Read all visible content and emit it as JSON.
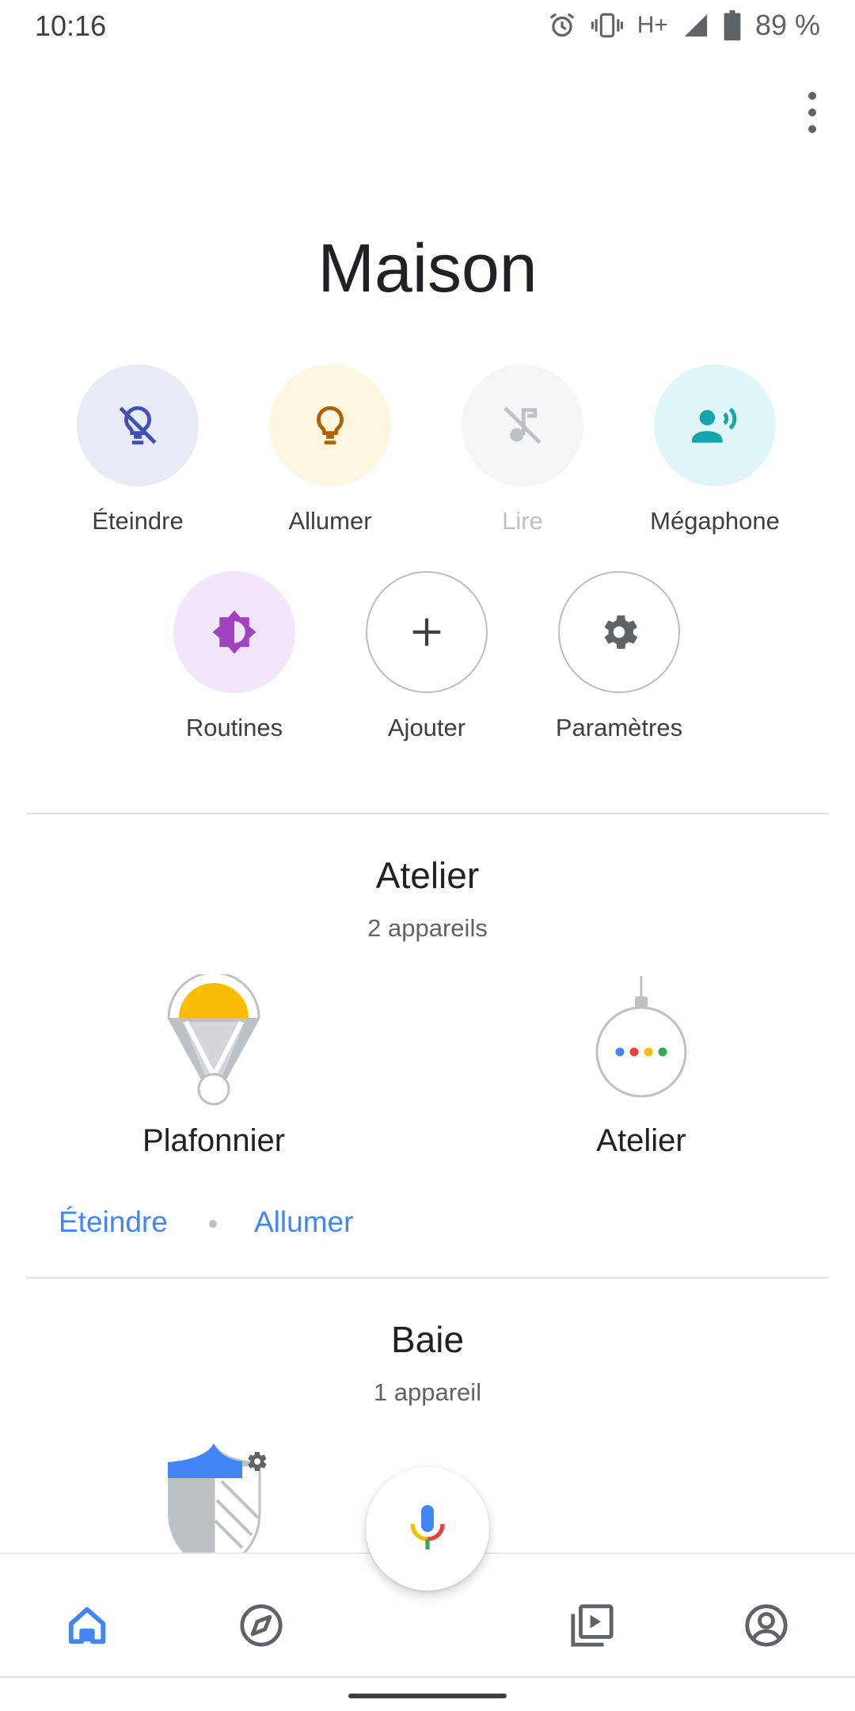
{
  "status_bar": {
    "time": "10:16",
    "network": "H+",
    "battery": "89 %",
    "icons": [
      "alarm-icon",
      "vibrate-icon",
      "signal-icon",
      "battery-icon"
    ]
  },
  "header": {
    "title": "Maison",
    "overflow_icon": "more-vert-icon"
  },
  "actions": [
    {
      "label": "Éteindre",
      "icon": "light-off-icon",
      "bg": "#e8eaf6",
      "fg": "#3f51b5",
      "enabled": true
    },
    {
      "label": "Allumer",
      "icon": "light-bulb-icon",
      "bg": "#fef7e0",
      "fg": "#b06000",
      "enabled": true
    },
    {
      "label": "Lire",
      "icon": "music-off-icon",
      "bg": "#f5f5f7",
      "fg": "#bdc1c6",
      "enabled": false
    },
    {
      "label": "Mégaphone",
      "icon": "broadcast-icon",
      "bg": "#e0f5f8",
      "fg": "#12a4af",
      "enabled": true
    },
    {
      "label": "Routines",
      "icon": "brightness-icon",
      "bg": "#f3e5fc",
      "fg": "#a142c0",
      "enabled": true
    },
    {
      "label": "Ajouter",
      "icon": "plus-icon",
      "enabled": true
    },
    {
      "label": "Paramètres",
      "icon": "gear-icon",
      "enabled": true
    }
  ],
  "rooms": [
    {
      "name": "Atelier",
      "count": "2 appareils",
      "devices": [
        {
          "name": "Plafonnier",
          "icon": "ceiling-light-icon"
        },
        {
          "name": "Atelier",
          "icon": "google-home-mini-icon"
        }
      ],
      "controls": [
        "Éteindre",
        "Allumer"
      ]
    },
    {
      "name": "Baie",
      "count": "1 appareil",
      "devices": [
        {
          "name": "",
          "icon": "security-shield-icon"
        }
      ]
    }
  ],
  "bottom_nav": [
    {
      "icon": "home-icon",
      "active": true
    },
    {
      "icon": "explore-icon",
      "active": false
    },
    {
      "icon": "media-icon",
      "active": false
    },
    {
      "icon": "account-icon",
      "active": false
    }
  ],
  "fab": {
    "icon": "microphone-icon"
  },
  "colors": {
    "accent": "#4285f4",
    "google_blue": "#4285f4",
    "google_red": "#ea4335",
    "google_yellow": "#fbbc04",
    "google_green": "#34a853"
  }
}
